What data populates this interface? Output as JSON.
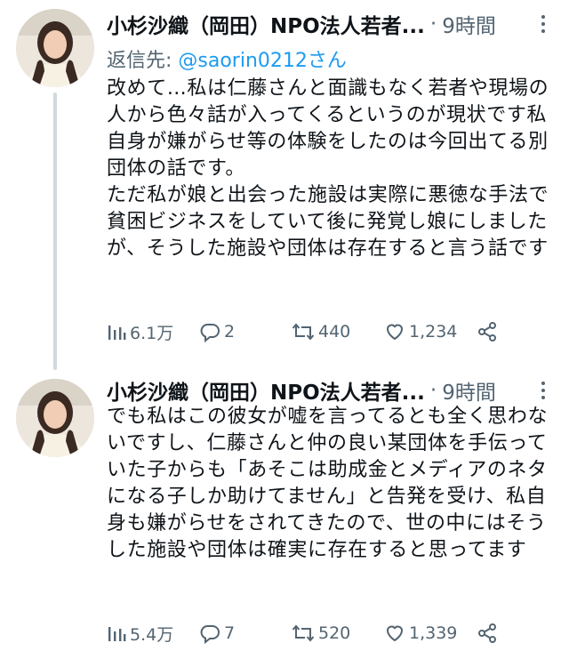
{
  "tweets": [
    {
      "author_name": "小杉沙織（岡田）NPO法人若者...",
      "separator": "·",
      "time": "9時間",
      "reply_prefix": "返信先: ",
      "reply_handle": "@saorin0212さん",
      "text": "改めて…私は仁藤さんと面識もなく若者や現場の人から色々話が入ってくるというのが現状です私自身が嫌がらせ等の体験をしたのは今回出てる別団体の話です。\nただ私が娘と出会った施設は実際に悪徳な手法で貧困ビジネスをしていて後に発覚し娘にしましたが、そうした施設や団体は存在すると言う話です",
      "views": "6.1万",
      "replies": "2",
      "retweets": "440",
      "likes": "1,234"
    },
    {
      "author_name": "小杉沙織（岡田）NPO法人若者...",
      "separator": "·",
      "time": "9時間",
      "text": "でも私はこの彼女が嘘を言ってるとも全く思わないですし、仁藤さんと仲の良い某団体を手伝っていた子からも「あそこは助成金とメディアのネタになる子しか助けてません」と告発を受け、私自身も嫌がらせをされてきたので、世の中にはそうした施設や団体は確実に存在すると思ってます",
      "views": "5.4万",
      "replies": "7",
      "retweets": "520",
      "likes": "1,339"
    }
  ],
  "colors": {
    "text": "#0f1419",
    "secondary": "#536471",
    "link": "#1d9bf0",
    "thread_line": "#cfd9de"
  }
}
